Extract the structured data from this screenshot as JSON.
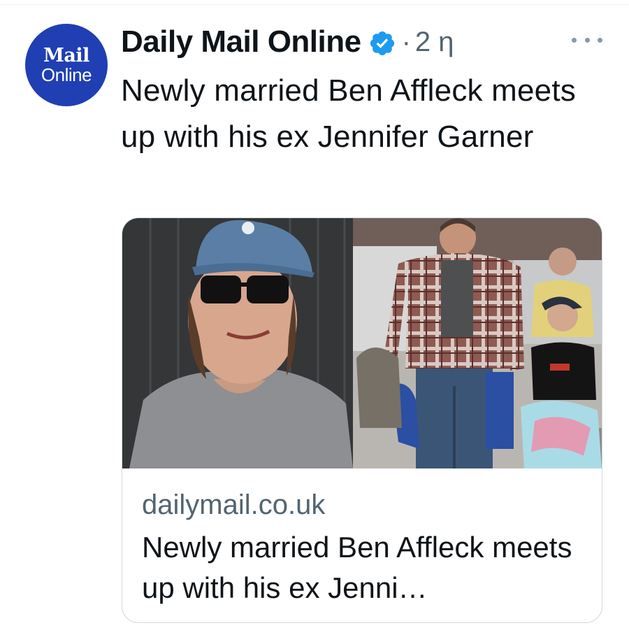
{
  "avatar": {
    "line1": "Mail",
    "line2": "Online"
  },
  "tweet": {
    "account_name": "Daily Mail Online",
    "separator": "·",
    "time": "2 η",
    "text": "Newly married Ben Affleck meets up with his ex Jennifer Garner"
  },
  "card": {
    "domain": "dailymail.co.uk",
    "title": "Newly married Ben Affleck meets up with his ex Jenni…"
  },
  "colors": {
    "avatar_bg": "#1f3fb3",
    "verified_blue": "#1d9bf0",
    "secondary_text": "#536471",
    "border": "#cfd9de"
  },
  "icons": [
    "verified-badge-icon",
    "more-options-icon"
  ]
}
